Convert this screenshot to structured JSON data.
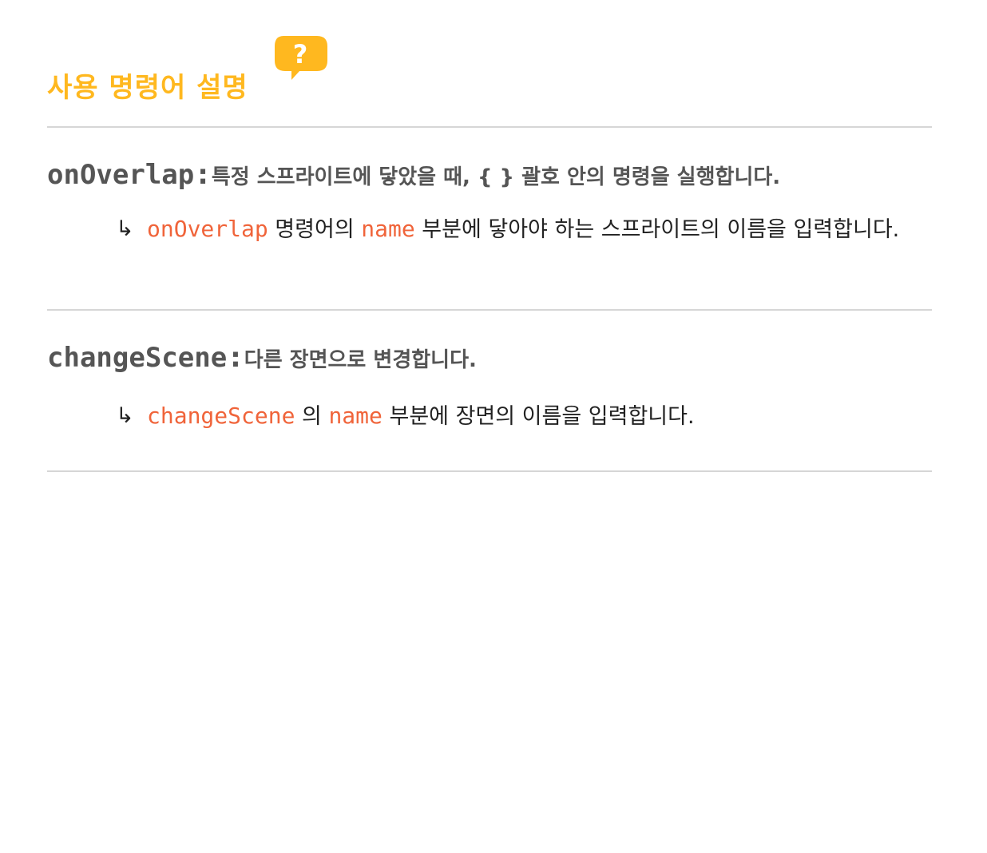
{
  "title": "사용 명령어 설명",
  "help_badge": {
    "icon": "question-bubble-icon",
    "glyph": "?",
    "color": "#FFB81F"
  },
  "commands": [
    {
      "name": "onOverlap",
      "colon": ":",
      "description": "특정 스프라이트에 닿았을 때, { } 괄호 안의 명령을 실행합니다.",
      "arrow": "↳",
      "detail": {
        "code1": "onOverlap",
        "text1": " 명령어의 ",
        "code2": "name",
        "text2": "  부분에 닿아야 하는 스프라이트의 이름을 입력합니다."
      }
    },
    {
      "name": "changeScene",
      "colon": ":",
      "description": "다른 장면으로 변경합니다.",
      "arrow": "↳",
      "detail": {
        "code1": "changeScene",
        "text1": "  의 ",
        "code2": "name",
        "text2": " 부분에 장면의 이름을 입력합니다."
      }
    }
  ],
  "colors": {
    "title": "#FFB81F",
    "heading": "#555555",
    "code": "#F0643A",
    "divider": "#d6d6d6"
  }
}
